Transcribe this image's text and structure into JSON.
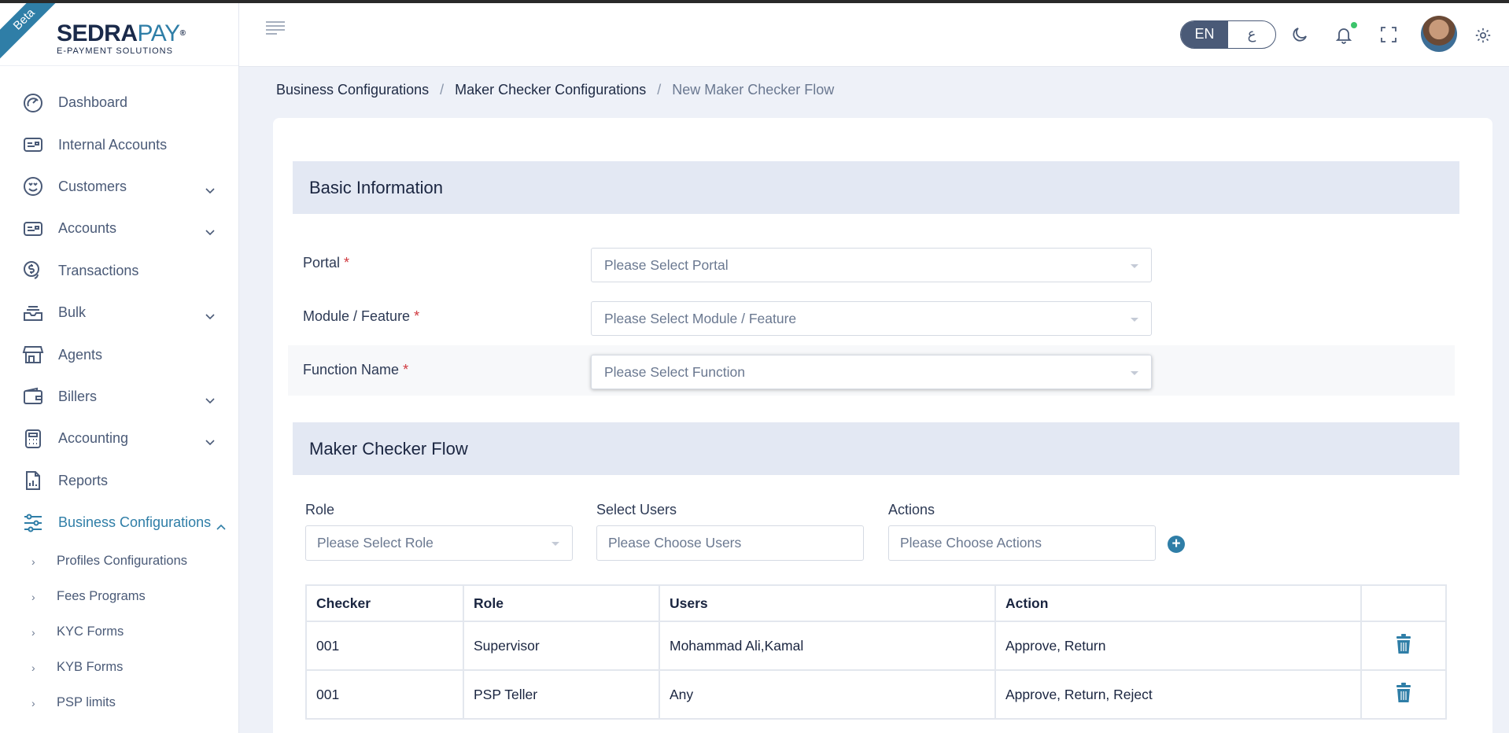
{
  "brand": {
    "beta": "Beta",
    "name_part1": "SEDRA",
    "name_part2": "PAY",
    "trademark": "®",
    "tagline": "E-PAYMENT SOLUTIONS",
    "accent_color": "#2f7ea7"
  },
  "sidebar": {
    "items": [
      {
        "label": "Dashboard",
        "icon": "dashboard-gauge-icon"
      },
      {
        "label": "Internal Accounts",
        "icon": "id-card-icon"
      },
      {
        "label": "Customers",
        "icon": "smiley-face-icon",
        "expandable": true
      },
      {
        "label": "Accounts",
        "icon": "id-card-icon",
        "expandable": true
      },
      {
        "label": "Transactions",
        "icon": "coin-transfer-icon"
      },
      {
        "label": "Bulk",
        "icon": "inbox-tray-icon",
        "expandable": true
      },
      {
        "label": "Agents",
        "icon": "storefront-icon"
      },
      {
        "label": "Billers",
        "icon": "wallet-icon",
        "expandable": true
      },
      {
        "label": "Accounting",
        "icon": "calculator-icon",
        "expandable": true
      },
      {
        "label": "Reports",
        "icon": "report-document-icon"
      },
      {
        "label": "Business Configurations",
        "icon": "sliders-icon",
        "expanded": true
      }
    ],
    "sub_items": [
      {
        "label": "Profiles Configurations"
      },
      {
        "label": "Fees Programs"
      },
      {
        "label": "KYC Forms"
      },
      {
        "label": "KYB Forms"
      },
      {
        "label": "PSP limits"
      }
    ]
  },
  "header": {
    "lang_en": "EN",
    "lang_ar": "ع"
  },
  "breadcrumb": {
    "level1": "Business Configurations",
    "level2": "Maker Checker Configurations",
    "current": "New Maker Checker Flow",
    "separator": "/"
  },
  "basic_info": {
    "title": "Basic Information",
    "portal_label": "Portal",
    "portal_placeholder": "Please Select Portal",
    "module_label": "Module / Feature",
    "module_placeholder": "Please Select Module / Feature",
    "function_label": "Function Name",
    "function_placeholder": "Please Select Function",
    "required_mark": "*"
  },
  "flow": {
    "title": "Maker Checker Flow",
    "role_label": "Role",
    "role_placeholder": "Please Select Role",
    "users_label": "Select Users",
    "users_placeholder": "Please Choose Users",
    "actions_label": "Actions",
    "actions_placeholder": "Please Choose Actions",
    "add_symbol": "+"
  },
  "table": {
    "columns": [
      "Checker",
      "Role",
      "Users",
      "Action",
      ""
    ],
    "rows": [
      {
        "checker": "001",
        "role": "Supervisor",
        "users": "Mohammad Ali,Kamal",
        "action": "Approve, Return"
      },
      {
        "checker": "001",
        "role": "PSP Teller",
        "users": "Any",
        "action": "Approve, Return, Reject"
      }
    ]
  }
}
